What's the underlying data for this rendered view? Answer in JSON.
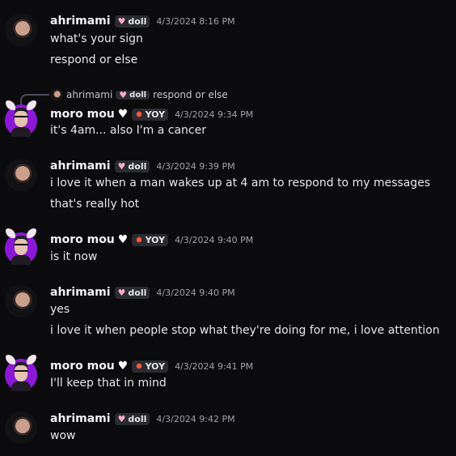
{
  "messages": [
    {
      "author": "ahrimami",
      "tag": "doll",
      "timestamp": "4/3/2024 8:16 PM",
      "lines": [
        "what's your sign",
        "respond or else"
      ]
    },
    {
      "author": "moro mou",
      "tag": "YOY",
      "timestamp": "4/3/2024 9:34 PM",
      "reply": {
        "author": "ahrimami",
        "tag": "doll",
        "text": "respond or else"
      },
      "lines": [
        "it's 4am... also I'm a cancer"
      ]
    },
    {
      "author": "ahrimami",
      "tag": "doll",
      "timestamp": "4/3/2024 9:39 PM",
      "lines": [
        "i love it when a man wakes up at 4 am to respond to my messages",
        "that's really hot"
      ]
    },
    {
      "author": "moro mou",
      "tag": "YOY",
      "timestamp": "4/3/2024 9:40 PM",
      "lines": [
        "is it now"
      ]
    },
    {
      "author": "ahrimami",
      "tag": "doll",
      "timestamp": "4/3/2024 9:40 PM",
      "lines": [
        "yes",
        "i love it when people stop what they're doing for me, i love attention"
      ]
    },
    {
      "author": "moro mou",
      "tag": "YOY",
      "timestamp": "4/3/2024 9:41 PM",
      "lines": [
        "I'll keep that in mind"
      ]
    },
    {
      "author": "ahrimami",
      "tag": "doll",
      "timestamp": "4/3/2024 9:42 PM",
      "lines": [
        "wow"
      ]
    }
  ],
  "icons": {
    "doll_tag": "heart-icon",
    "yoy_tag": "fire-icon",
    "name_suffix": "white-heart-icon"
  },
  "colors": {
    "background": "#0b0b0e",
    "username": "#f2f3f5",
    "timestamp": "#a0a2aa",
    "tag_bg": "#2a2b31",
    "moro_avatar": "#8b18d6"
  }
}
